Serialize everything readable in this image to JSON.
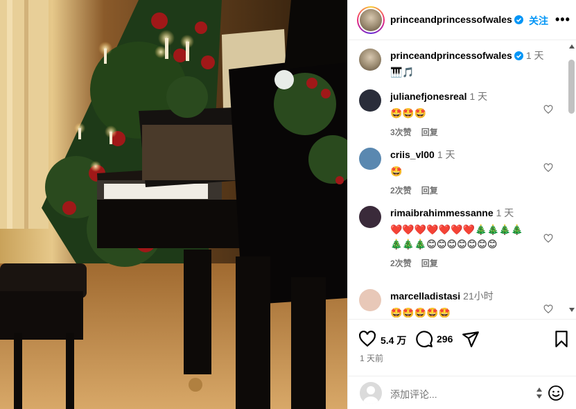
{
  "post": {
    "username": "princeandprincessofwales",
    "follow_label": "关注",
    "more_label": "•••",
    "caption": {
      "username": "princeandprincessofwales",
      "time": "1 天",
      "text": "🎹🎵"
    }
  },
  "comments": [
    {
      "username": "julianefjonesreal",
      "time": "1 天",
      "text": "🤩🤩🤩",
      "likes": "3次赞",
      "reply": "回复",
      "avatar_color": "#2a2d3a"
    },
    {
      "username": "criis_vl00",
      "time": "1 天",
      "text": "🤩",
      "likes": "2次赞",
      "reply": "回复",
      "avatar_color": "#5a88b0"
    },
    {
      "username": "rimaibrahimmessanne",
      "time": "1 天",
      "text": "❤️❤️❤️❤️❤️❤️❤️🎄🎄🎄🎄🎄🎄🎄😊😊😊😊😊😊😊",
      "likes": "2次赞",
      "reply": "回复",
      "avatar_color": "#3a2a3a"
    },
    {
      "username": "marcelladistasi",
      "time": "21小时",
      "text": "🤩🤩🤩🤩🤩",
      "likes": "",
      "reply": "",
      "avatar_color": "#e8c8b8"
    }
  ],
  "actions": {
    "likes_count": "5.4 万",
    "comments_count": "296",
    "posted_ago": "1 天前"
  },
  "add_comment": {
    "placeholder": "添加评论..."
  },
  "colors": {
    "accent": "#0095f6",
    "verified": "#0095f6",
    "muted": "#737373"
  }
}
